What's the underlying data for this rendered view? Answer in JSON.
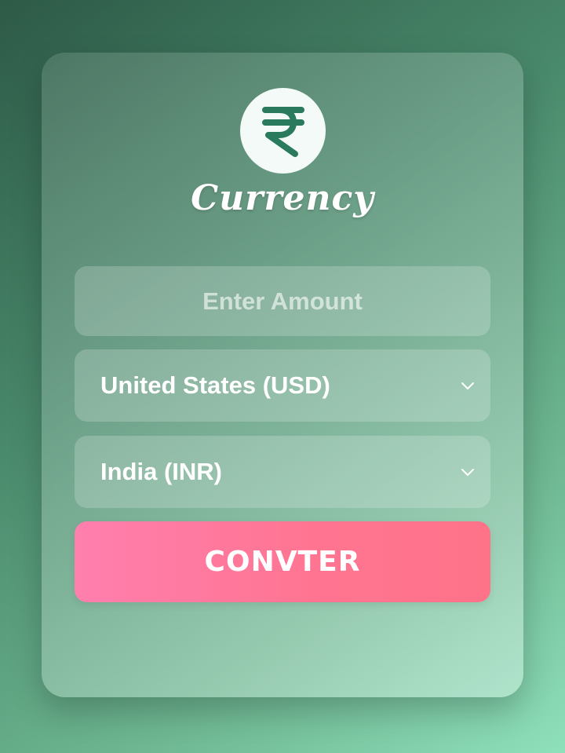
{
  "app": {
    "logo_symbol": "₹",
    "logo_icon": "rupee-icon",
    "title": "Currency"
  },
  "form": {
    "amount": {
      "value": "",
      "placeholder": "Enter Amount"
    },
    "from_currency": {
      "selected": "United States (USD)"
    },
    "to_currency": {
      "selected": "India (INR)"
    },
    "convert_button_label": "CONVTER"
  },
  "colors": {
    "accent_button": "#ff7a98",
    "logo_symbol": "#2a7a5e",
    "background_dark": "#2d5a47",
    "background_light": "#8ee0bb"
  }
}
